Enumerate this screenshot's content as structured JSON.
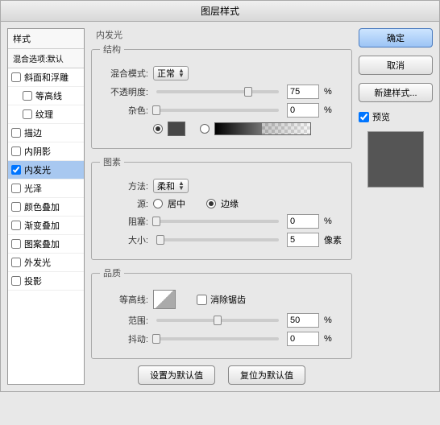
{
  "title": "图层样式",
  "sidebar": {
    "header": "样式",
    "sub": "混合选项:默认",
    "items": [
      {
        "label": "斜面和浮雕",
        "checked": false,
        "indent": false
      },
      {
        "label": "等高线",
        "checked": false,
        "indent": true
      },
      {
        "label": "纹理",
        "checked": false,
        "indent": true
      },
      {
        "label": "描边",
        "checked": false,
        "indent": false
      },
      {
        "label": "内阴影",
        "checked": false,
        "indent": false
      },
      {
        "label": "内发光",
        "checked": true,
        "indent": false,
        "selected": true
      },
      {
        "label": "光泽",
        "checked": false,
        "indent": false
      },
      {
        "label": "颜色叠加",
        "checked": false,
        "indent": false
      },
      {
        "label": "渐变叠加",
        "checked": false,
        "indent": false
      },
      {
        "label": "图案叠加",
        "checked": false,
        "indent": false
      },
      {
        "label": "外发光",
        "checked": false,
        "indent": false
      },
      {
        "label": "投影",
        "checked": false,
        "indent": false
      }
    ]
  },
  "panel": {
    "title": "内发光",
    "structure": {
      "legend": "结构",
      "blend_label": "混合模式:",
      "blend_value": "正常",
      "opacity_label": "不透明度:",
      "opacity_value": "75",
      "opacity_unit": "%",
      "noise_label": "杂色:",
      "noise_value": "0",
      "noise_unit": "%",
      "color_swatch": "#474747"
    },
    "elements": {
      "legend": "图素",
      "method_label": "方法:",
      "method_value": "柔和",
      "source_label": "源:",
      "source_center": "居中",
      "source_edge": "边缘",
      "source_selected": "edge",
      "choke_label": "阻塞:",
      "choke_value": "0",
      "choke_unit": "%",
      "size_label": "大小:",
      "size_value": "5",
      "size_unit": "像素"
    },
    "quality": {
      "legend": "品质",
      "contour_label": "等高线:",
      "antialias_label": "消除锯齿",
      "antialias_checked": false,
      "range_label": "范围:",
      "range_value": "50",
      "range_unit": "%",
      "jitter_label": "抖动:",
      "jitter_value": "0",
      "jitter_unit": "%"
    },
    "buttons": {
      "set_default": "设置为默认值",
      "reset_default": "复位为默认值"
    }
  },
  "right": {
    "ok": "确定",
    "cancel": "取消",
    "new_style": "新建样式...",
    "preview_label": "预览",
    "preview_checked": true
  }
}
